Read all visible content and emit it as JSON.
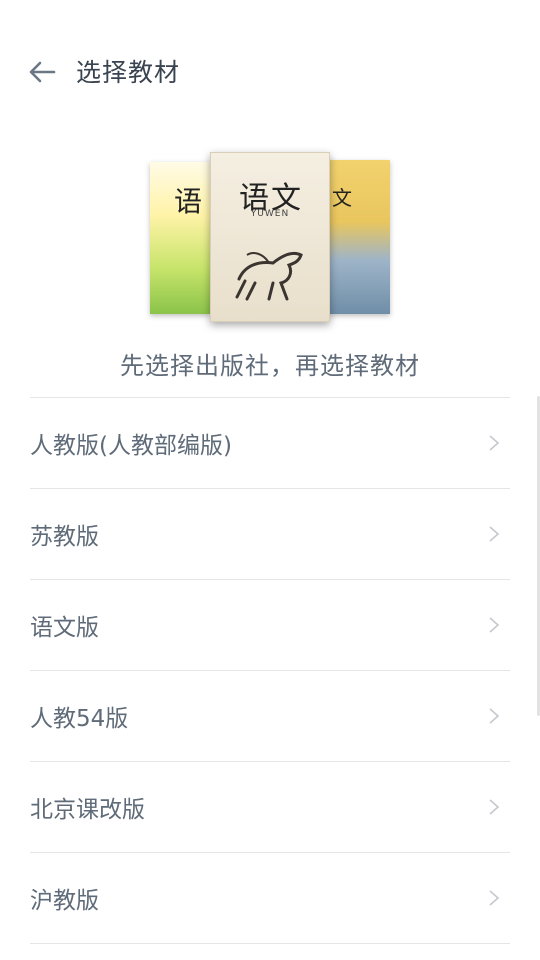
{
  "header": {
    "title": "选择教材"
  },
  "hero": {
    "subtitle": "先选择出版社，再选择教材"
  },
  "covers": {
    "left_char": "语",
    "mid_char": "语文",
    "mid_sub": "YUWEN",
    "right_char": "文"
  },
  "publishers": [
    {
      "label": "人教版(人教部编版)"
    },
    {
      "label": "苏教版"
    },
    {
      "label": "语文版"
    },
    {
      "label": "人教54版"
    },
    {
      "label": "北京课改版"
    },
    {
      "label": "沪教版"
    }
  ],
  "colors": {
    "text": "#5f6b78",
    "divider": "#e6e6e6",
    "icon": "#6b7785"
  }
}
